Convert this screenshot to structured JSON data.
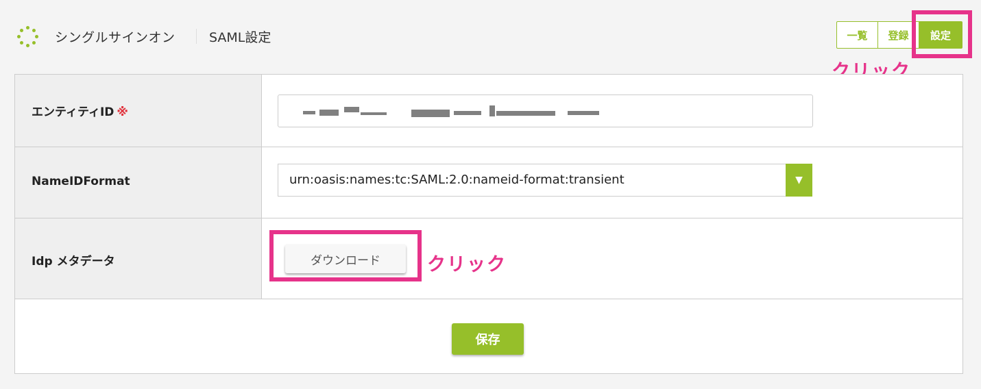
{
  "header": {
    "title": "シングルサインオン",
    "subtitle": "SAML設定",
    "nav": {
      "list_label": "一覧",
      "register_label": "登録",
      "settings_label": "設定"
    }
  },
  "annotations": {
    "top_click": "クリック",
    "download_click": "クリック"
  },
  "form": {
    "entity_id": {
      "label": "エンティティID",
      "required_mark": "※"
    },
    "name_id_format": {
      "label": "NameIDFormat",
      "value": "urn:oasis:names:tc:SAML:2.0:nameid-format:transient"
    },
    "idp_metadata": {
      "label": "Idp メタデータ",
      "download_label": "ダウンロード"
    },
    "save_label": "保存"
  },
  "colors": {
    "accent": "#96bf2a",
    "annotation": "#e6338a",
    "required": "#e0303a"
  },
  "icons": {
    "logo": "dotted-circle-logo-icon",
    "dropdown": "triangle-down-icon"
  }
}
